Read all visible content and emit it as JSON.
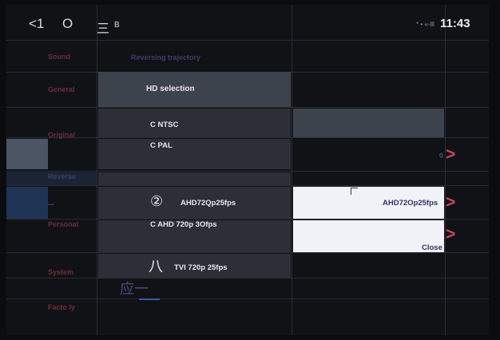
{
  "status": {
    "back": "<1",
    "home": "O",
    "menu": "三",
    "b": "B",
    "signal": "* • «-lll",
    "time": "11:43"
  },
  "sidebar": {
    "items": [
      "Sound",
      "General",
      "Original",
      "Reverse",
      "...",
      "Personal",
      "System",
      "Facto ly"
    ]
  },
  "header": {
    "label": "Reversing trajectory"
  },
  "options": {
    "hd_selection": "HD selection",
    "ntsc": "C NTSC",
    "pal": "C PAL",
    "ahd25_glyph": "②",
    "ahd25": "AHD72Qp25fps",
    "ahd30": "C AHD 720p 3Ofps",
    "tvi_glyph": "八",
    "tvi": "TVI 720p 25fps",
    "bottom_glyph": "应一"
  },
  "right": {
    "zero": "0",
    "selected_value": "AHD72Op25fps",
    "close": "Close",
    "chevron": ">"
  },
  "colors": {
    "accent": "#c9485a",
    "panel": "#f0f2f7",
    "row": "#2c2f35",
    "selected_row": "#3d434c"
  }
}
